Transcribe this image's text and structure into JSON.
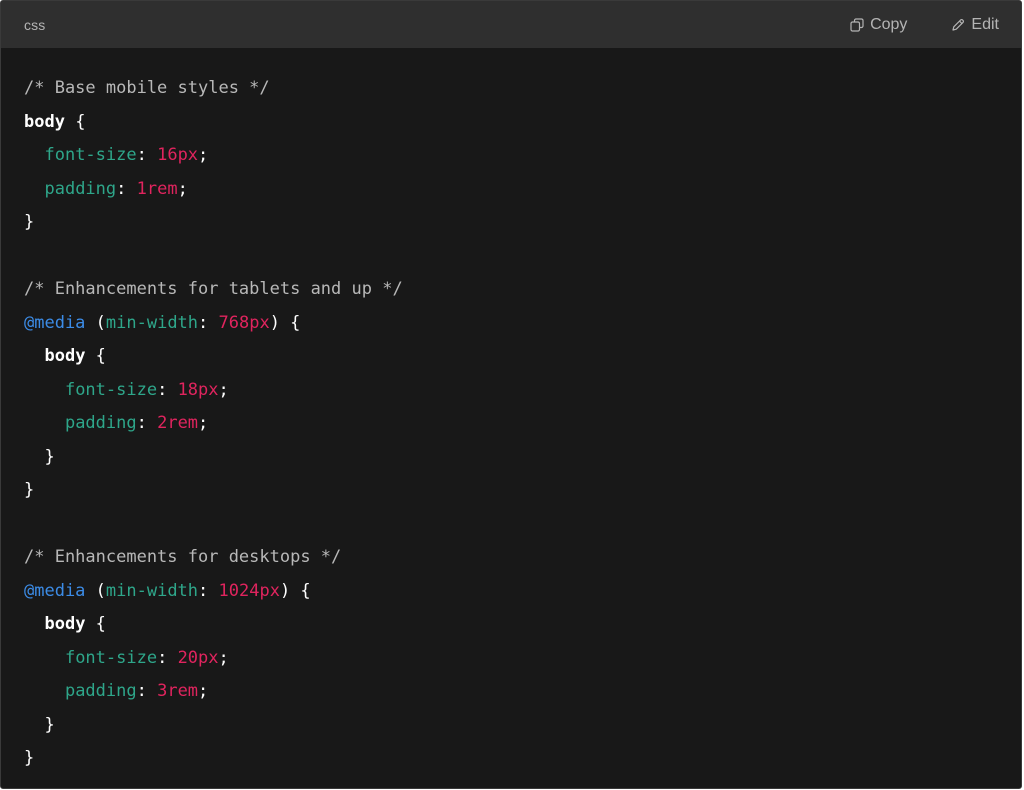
{
  "header": {
    "language": "css",
    "copy_label": "Copy",
    "edit_label": "Edit",
    "copy_icon": "copy-icon",
    "edit_icon": "pencil-icon"
  },
  "colors": {
    "background": "#181818",
    "header_background": "#2f2f2f",
    "comment": "#b8b8b8",
    "property": "#2ea68a",
    "value": "#e0245e",
    "at_rule": "#3c8ce7",
    "text": "#ffffff"
  },
  "code": {
    "lines": [
      [
        {
          "t": "/* Base mobile styles */",
          "c": "comment"
        }
      ],
      [
        {
          "t": "body",
          "c": "selector"
        },
        {
          "t": " {",
          "c": "punct"
        }
      ],
      [
        {
          "t": "  ",
          "c": "punct"
        },
        {
          "t": "font-size",
          "c": "prop"
        },
        {
          "t": ": ",
          "c": "punct"
        },
        {
          "t": "16px",
          "c": "value"
        },
        {
          "t": ";",
          "c": "punct"
        }
      ],
      [
        {
          "t": "  ",
          "c": "punct"
        },
        {
          "t": "padding",
          "c": "prop"
        },
        {
          "t": ": ",
          "c": "punct"
        },
        {
          "t": "1rem",
          "c": "value"
        },
        {
          "t": ";",
          "c": "punct"
        }
      ],
      [
        {
          "t": "}",
          "c": "punct"
        }
      ],
      [],
      [
        {
          "t": "/* Enhancements for tablets and up */",
          "c": "comment"
        }
      ],
      [
        {
          "t": "@media",
          "c": "at"
        },
        {
          "t": " (",
          "c": "punct"
        },
        {
          "t": "min-width",
          "c": "feature"
        },
        {
          "t": ": ",
          "c": "punct"
        },
        {
          "t": "768px",
          "c": "value"
        },
        {
          "t": ") {",
          "c": "punct"
        }
      ],
      [
        {
          "t": "  ",
          "c": "punct"
        },
        {
          "t": "body",
          "c": "selector"
        },
        {
          "t": " {",
          "c": "punct"
        }
      ],
      [
        {
          "t": "    ",
          "c": "punct"
        },
        {
          "t": "font-size",
          "c": "prop"
        },
        {
          "t": ": ",
          "c": "punct"
        },
        {
          "t": "18px",
          "c": "value"
        },
        {
          "t": ";",
          "c": "punct"
        }
      ],
      [
        {
          "t": "    ",
          "c": "punct"
        },
        {
          "t": "padding",
          "c": "prop"
        },
        {
          "t": ": ",
          "c": "punct"
        },
        {
          "t": "2rem",
          "c": "value"
        },
        {
          "t": ";",
          "c": "punct"
        }
      ],
      [
        {
          "t": "  }",
          "c": "punct"
        }
      ],
      [
        {
          "t": "}",
          "c": "punct"
        }
      ],
      [],
      [
        {
          "t": "/* Enhancements for desktops */",
          "c": "comment"
        }
      ],
      [
        {
          "t": "@media",
          "c": "at"
        },
        {
          "t": " (",
          "c": "punct"
        },
        {
          "t": "min-width",
          "c": "feature"
        },
        {
          "t": ": ",
          "c": "punct"
        },
        {
          "t": "1024px",
          "c": "value"
        },
        {
          "t": ") {",
          "c": "punct"
        }
      ],
      [
        {
          "t": "  ",
          "c": "punct"
        },
        {
          "t": "body",
          "c": "selector"
        },
        {
          "t": " {",
          "c": "punct"
        }
      ],
      [
        {
          "t": "    ",
          "c": "punct"
        },
        {
          "t": "font-size",
          "c": "prop"
        },
        {
          "t": ": ",
          "c": "punct"
        },
        {
          "t": "20px",
          "c": "value"
        },
        {
          "t": ";",
          "c": "punct"
        }
      ],
      [
        {
          "t": "    ",
          "c": "punct"
        },
        {
          "t": "padding",
          "c": "prop"
        },
        {
          "t": ": ",
          "c": "punct"
        },
        {
          "t": "3rem",
          "c": "value"
        },
        {
          "t": ";",
          "c": "punct"
        }
      ],
      [
        {
          "t": "  }",
          "c": "punct"
        }
      ],
      [
        {
          "t": "}",
          "c": "punct"
        }
      ]
    ]
  }
}
